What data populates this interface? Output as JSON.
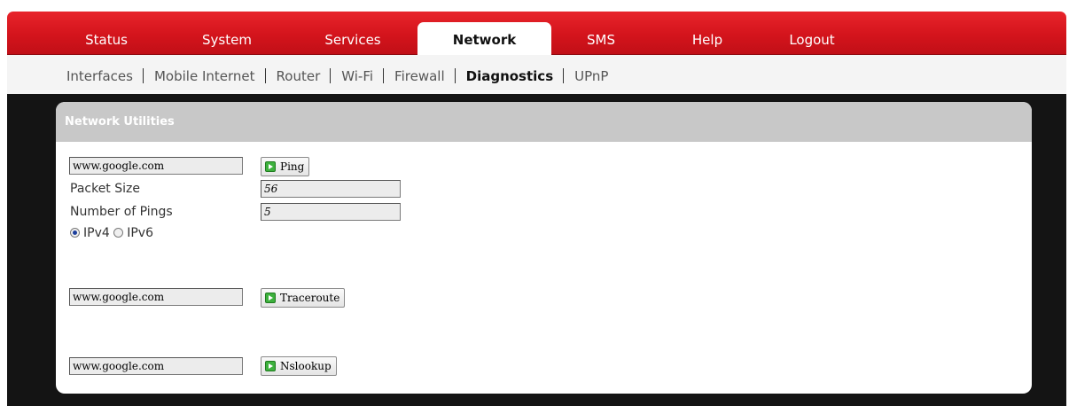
{
  "tabs": [
    {
      "label": "Status",
      "active": false
    },
    {
      "label": "System",
      "active": false
    },
    {
      "label": "Services",
      "active": false
    },
    {
      "label": "Network",
      "active": true
    },
    {
      "label": "SMS",
      "active": false
    },
    {
      "label": "Help",
      "active": false
    },
    {
      "label": "Logout",
      "active": false
    }
  ],
  "subnav": [
    {
      "label": "Interfaces",
      "active": false
    },
    {
      "label": "Mobile Internet",
      "active": false
    },
    {
      "label": "Router",
      "active": false
    },
    {
      "label": "Wi-Fi",
      "active": false
    },
    {
      "label": "Firewall",
      "active": false
    },
    {
      "label": "Diagnostics",
      "active": true
    },
    {
      "label": "UPnP",
      "active": false
    }
  ],
  "panel": {
    "title": "Network Utilities",
    "ping": {
      "host_value": "www.google.com",
      "button_label": "Ping",
      "packet_size_label": "Packet Size",
      "packet_size_value": "56",
      "num_pings_label": "Number of Pings",
      "num_pings_value": "5",
      "ipv4_label": "IPv4",
      "ipv6_label": "IPv6",
      "ip_selected": "IPv4"
    },
    "traceroute": {
      "host_value": "www.google.com",
      "button_label": "Traceroute"
    },
    "nslookup": {
      "host_value": "www.google.com",
      "button_label": "Nslookup"
    }
  },
  "colors": {
    "brand_red": "#d4141c",
    "dark_background": "#141414",
    "panel_header": "#c8c8c8",
    "button_icon_green": "#3db13d"
  },
  "icons": {
    "button_icon": "green-play-icon"
  }
}
